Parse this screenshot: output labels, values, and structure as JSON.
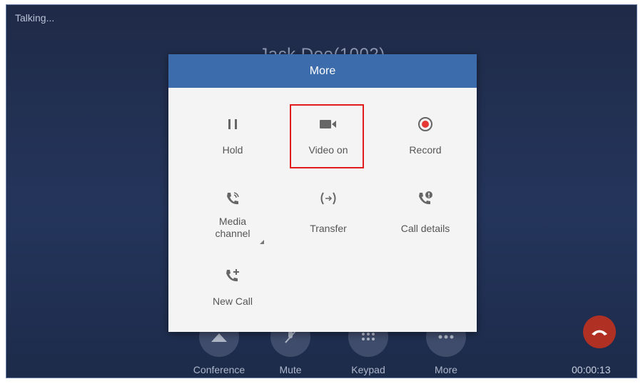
{
  "call": {
    "status": "Talking...",
    "caller": "Jack Doe(1002)",
    "timer": "00:00:13"
  },
  "bottom_bar": {
    "conference": "Conference",
    "mute": "Mute",
    "keypad": "Keypad",
    "more": "More"
  },
  "modal": {
    "title": "More",
    "items": [
      {
        "label": "Hold",
        "icon": "pause-icon"
      },
      {
        "label": "Video on",
        "icon": "video-camera-icon"
      },
      {
        "label": "Record",
        "icon": "record-icon"
      },
      {
        "label": "Media channel",
        "icon": "phone-signal-icon"
      },
      {
        "label": "Transfer",
        "icon": "transfer-icon"
      },
      {
        "label": "Call details",
        "icon": "phone-info-icon"
      },
      {
        "label": "New Call",
        "icon": "phone-add-icon"
      }
    ]
  },
  "colors": {
    "header": "#3c6cab",
    "highlight": "#e01c1c",
    "record": "#e53935",
    "end_call": "#b03023"
  }
}
